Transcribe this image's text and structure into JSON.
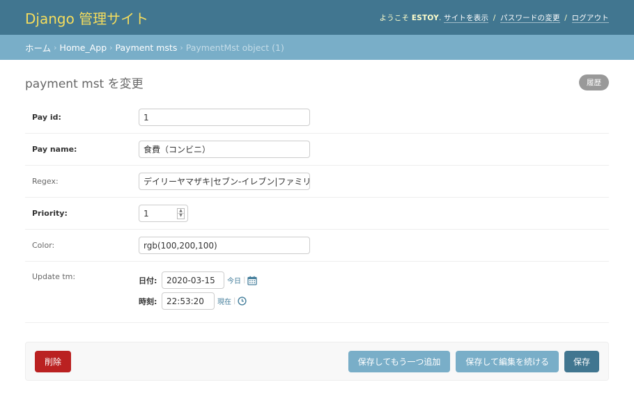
{
  "header": {
    "branding": "Django 管理サイト",
    "greeting": "ようこそ",
    "username": "ESTOY",
    "view_site": "サイトを表示",
    "change_password": "パスワードの変更",
    "logout": "ログアウト",
    "separator": "/"
  },
  "breadcrumbs": {
    "home": "ホーム",
    "app": "Home_App",
    "model": "Payment msts",
    "current": "PaymentMst object (1)",
    "arrow": "›"
  },
  "page": {
    "title": "payment mst を変更",
    "history_label": "履歴"
  },
  "fields": {
    "pay_id": {
      "label": "Pay id:",
      "value": "1"
    },
    "pay_name": {
      "label": "Pay name:",
      "value": "食費（コンビニ）"
    },
    "regex": {
      "label": "Regex:",
      "value": "デイリーヤマザキ|セブン-イレブン|ファミリ"
    },
    "priority": {
      "label": "Priority:",
      "value": "1"
    },
    "color": {
      "label": "Color:",
      "value": "rgb(100,200,100)"
    },
    "update_tm": {
      "label": "Update tm:",
      "date_label": "日付:",
      "date_value": "2020-03-15",
      "today_link": "今日",
      "time_label": "時刻:",
      "time_value": "22:53:20",
      "now_link": "現在",
      "pipe": "|"
    }
  },
  "actions": {
    "delete": "削除",
    "save_add_another": "保存してもう一つ追加",
    "save_continue": "保存して編集を続ける",
    "save": "保存"
  },
  "colors": {
    "header_bg": "#417690",
    "breadcrumb_bg": "#79aec8",
    "branding": "#f5dd5d",
    "delete": "#ba2121"
  },
  "icons": {
    "calendar": "calendar-icon",
    "clock": "clock-icon",
    "spin_up": "spin-up-icon",
    "spin_down": "spin-down-icon"
  }
}
